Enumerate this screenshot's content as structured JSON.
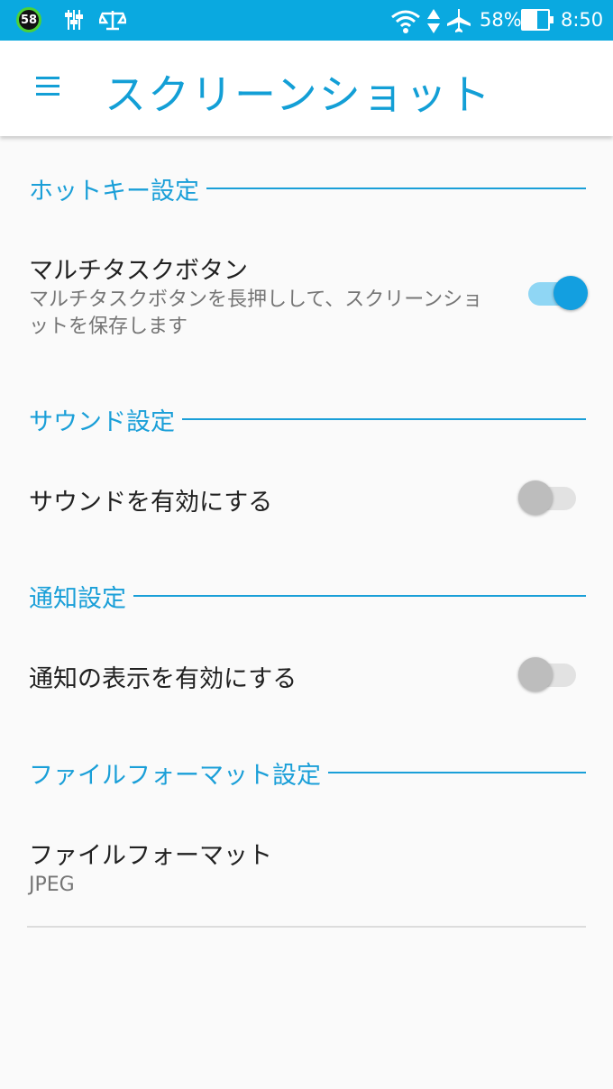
{
  "status_bar": {
    "badge": "58",
    "battery_percent": "58%",
    "time": "8:50",
    "battery_level": 0.58,
    "icons": [
      "notification-badge-icon",
      "equalizer-icon",
      "scale-icon",
      "wifi-icon",
      "data-arrows-icon",
      "airplane-icon",
      "battery-icon"
    ]
  },
  "app_bar": {
    "title": "スクリーンショット",
    "menu_icon": "hamburger-menu-icon"
  },
  "sections": {
    "hotkey": {
      "header": "ホットキー設定",
      "item_title": "マルチタスクボタン",
      "item_summary": "マルチタスクボタンを長押しして、スクリーンショットを保存します",
      "switch_on": true
    },
    "sound": {
      "header": "サウンド設定",
      "item_title": "サウンドを有効にする",
      "switch_on": false
    },
    "notification": {
      "header": "通知設定",
      "item_title": "通知の表示を有効にする",
      "switch_on": false
    },
    "file_format": {
      "header": "ファイルフォーマット設定",
      "item_title": "ファイルフォーマット",
      "item_value": "JPEG"
    }
  },
  "colors": {
    "status_bar": "#0aa9e0",
    "accent": "#139fd6",
    "switch_on_thumb": "#139fe0",
    "switch_on_track": "#8fd6f4",
    "switch_off_thumb": "#bdbdbd",
    "switch_off_track": "#e2e2e2"
  }
}
